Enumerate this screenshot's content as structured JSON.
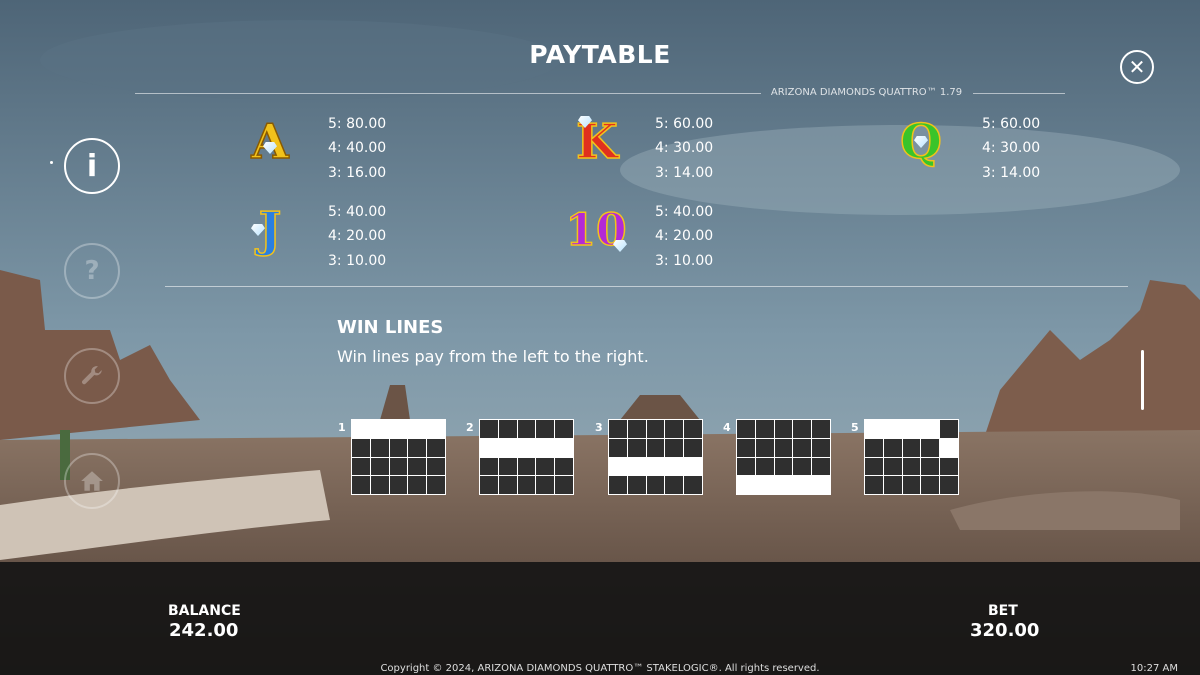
{
  "header": {
    "title": "PAYTABLE",
    "version": "ARIZONA DIAMONDS QUATTRO™ 1.79"
  },
  "icons": {
    "close": "close-icon",
    "info": "info-icon",
    "help": "help-icon",
    "settings": "wrench-icon",
    "home": "home-icon"
  },
  "side": {
    "info_glyph": "i",
    "help_glyph": "?"
  },
  "close_glyph": "✕",
  "symbols": [
    {
      "glyph": "A",
      "color": "#f2c21b",
      "pays": [
        "5: 80.00",
        "4: 40.00",
        "3: 16.00"
      ]
    },
    {
      "glyph": "K",
      "color": "#e0301e",
      "pays": [
        "5: 60.00",
        "4: 30.00",
        "3: 14.00"
      ]
    },
    {
      "glyph": "Q",
      "color": "#39c42a",
      "pays": [
        "5: 60.00",
        "4: 30.00",
        "3: 14.00"
      ]
    },
    {
      "glyph": "J",
      "color": "#2a7fe0",
      "pays": [
        "5: 40.00",
        "4: 20.00",
        "3: 10.00"
      ]
    },
    {
      "glyph": "10",
      "color": "#b329d6",
      "pays": [
        "5: 40.00",
        "4: 20.00",
        "3: 10.00"
      ]
    }
  ],
  "win_lines": {
    "title": "WIN LINES",
    "description": "Win lines pay from the left to the right.",
    "lines": [
      {
        "number": "1",
        "rows": [
          1,
          1,
          1,
          1,
          1
        ]
      },
      {
        "number": "2",
        "rows": [
          2,
          2,
          2,
          2,
          2
        ]
      },
      {
        "number": "3",
        "rows": [
          3,
          3,
          3,
          3,
          3
        ]
      },
      {
        "number": "4",
        "rows": [
          4,
          4,
          4,
          4,
          4
        ]
      },
      {
        "number": "5",
        "rows": [
          1,
          1,
          1,
          1,
          2
        ]
      }
    ]
  },
  "footer": {
    "balance_label": "BALANCE",
    "balance_value": "242.00",
    "bet_label": "BET",
    "bet_value": "320.00",
    "copyright": "Copyright © 2024, ARIZONA DIAMONDS QUATTRO™ STAKELOGIC®. All rights reserved.",
    "time": "10:27 AM"
  },
  "colors": {
    "sky": "#6f8a9c",
    "ground": "#6e5a4c",
    "panel": "#141414"
  }
}
